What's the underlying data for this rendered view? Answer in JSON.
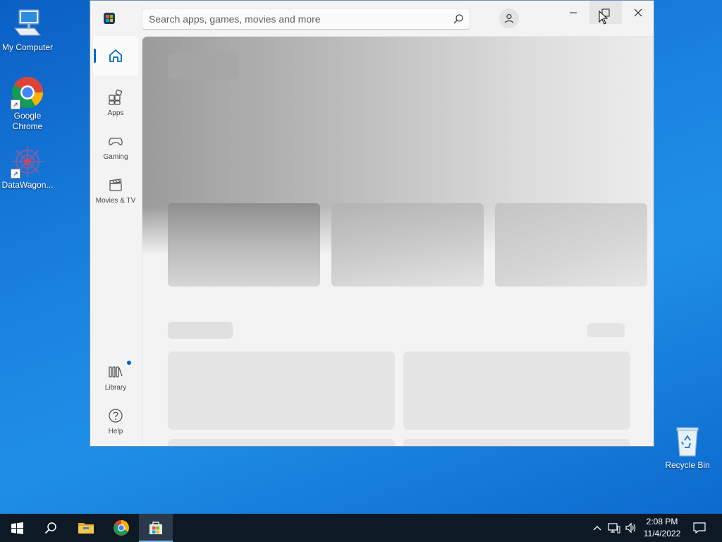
{
  "desktop": {
    "icons": [
      {
        "label": "My Computer"
      },
      {
        "label": "Google Chrome"
      },
      {
        "label": "DataWagon..."
      },
      {
        "label": "Recycle Bin"
      }
    ]
  },
  "window": {
    "app": "Microsoft Store",
    "search": {
      "placeholder": "Search apps, games, movies and more"
    },
    "nav": [
      {
        "label": "",
        "icon": "home-icon",
        "active": true
      },
      {
        "label": "Apps",
        "icon": "apps-icon"
      },
      {
        "label": "Gaming",
        "icon": "gamepad-icon"
      },
      {
        "label": "Movies & TV",
        "icon": "clapperboard-icon"
      },
      {
        "label": "Library",
        "icon": "library-icon",
        "badge": true
      },
      {
        "label": "Help",
        "icon": "help-icon"
      }
    ],
    "accent": "#0067c0"
  },
  "taskbar": {
    "time": "2:08 PM",
    "date": "11/4/2022"
  }
}
